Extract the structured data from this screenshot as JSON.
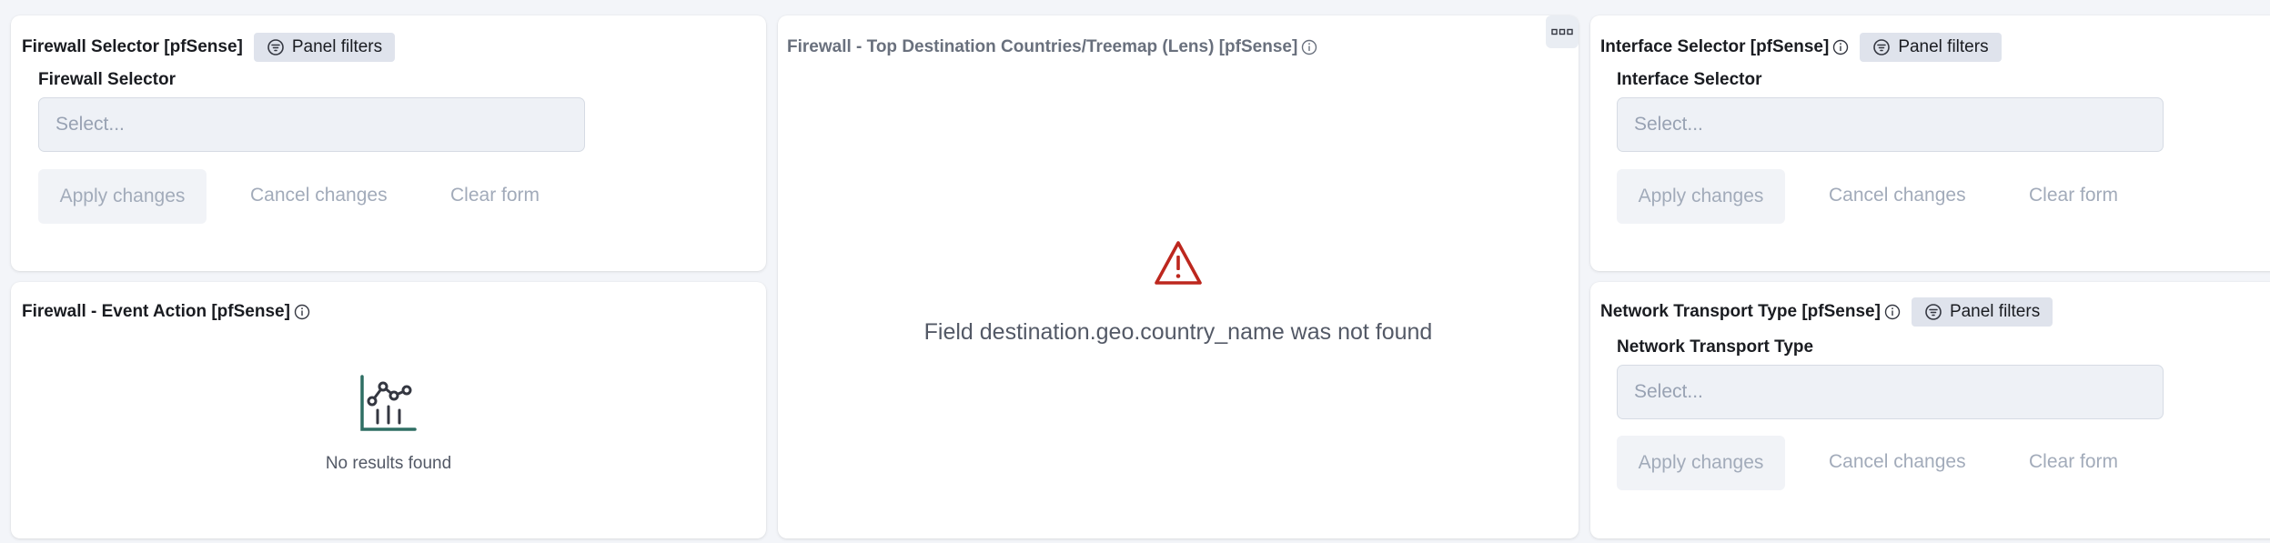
{
  "panels": {
    "firewall_selector": {
      "title": "Firewall Selector [pfSense]",
      "badge": "Panel filters",
      "field_label": "Firewall Selector",
      "placeholder": "Select...",
      "apply": "Apply changes",
      "cancel": "Cancel changes",
      "clear": "Clear form"
    },
    "event_action": {
      "title": "Firewall - Event Action [pfSense]",
      "empty_message": "No results found"
    },
    "treemap": {
      "title": "Firewall - Top Destination Countries/Treemap (Lens) [pfSense]",
      "error_message": "Field destination.geo.country_name was not found"
    },
    "interface_selector": {
      "title": "Interface Selector [pfSense]",
      "badge": "Panel filters",
      "field_label": "Interface Selector",
      "placeholder": "Select...",
      "apply": "Apply changes",
      "cancel": "Cancel changes",
      "clear": "Clear form"
    },
    "transport_type": {
      "title": "Network Transport Type [pfSense]",
      "badge": "Panel filters",
      "field_label": "Network Transport Type",
      "placeholder": "Select...",
      "apply": "Apply changes",
      "cancel": "Cancel changes",
      "clear": "Clear form"
    }
  },
  "colors": {
    "error_icon": "#bd271e",
    "empty_icon_accent": "#2e6e63"
  }
}
